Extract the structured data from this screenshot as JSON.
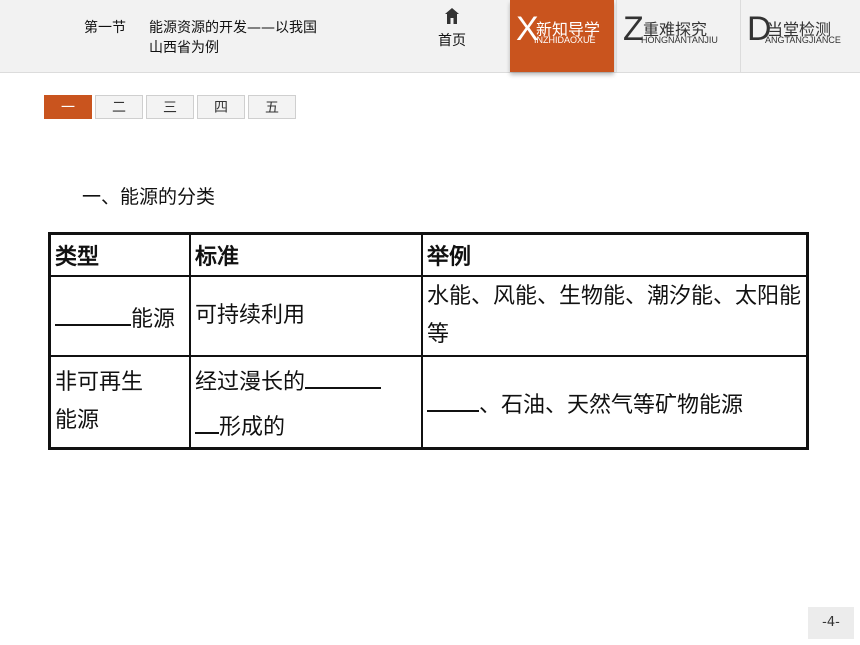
{
  "header": {
    "lesson_label": "第一节",
    "lesson_title": "能源资源的开发——以我国山西省为例",
    "home_label": "首页",
    "home_icon": "home-icon",
    "tabs": [
      {
        "letter": "X",
        "label": "新知导学",
        "pinyin": "INZHIDAOXUE",
        "active": true
      },
      {
        "letter": "Z",
        "label": "重难探究",
        "pinyin": "HONGNANTANJIU",
        "active": false
      },
      {
        "letter": "D",
        "label": "当堂检测",
        "pinyin": "ANGTANGJIANCE",
        "active": false
      }
    ]
  },
  "sections": [
    "一",
    "二",
    "三",
    "四",
    "五"
  ],
  "heading": "一、能源的分类",
  "table": {
    "headers": [
      "类型",
      "标准",
      "举例"
    ],
    "row1": {
      "type": "能源",
      "standard": "可持续利用",
      "example": "水能、风能、生物能、潮汐能、太阳能等"
    },
    "row2": {
      "type": "非可再生能源",
      "standard_a": "经过漫长的",
      "standard_b": "形成的",
      "example": "、石油、天然气等矿物能源"
    }
  },
  "page_number": "-4-",
  "colors": {
    "accent": "#c9541e"
  }
}
